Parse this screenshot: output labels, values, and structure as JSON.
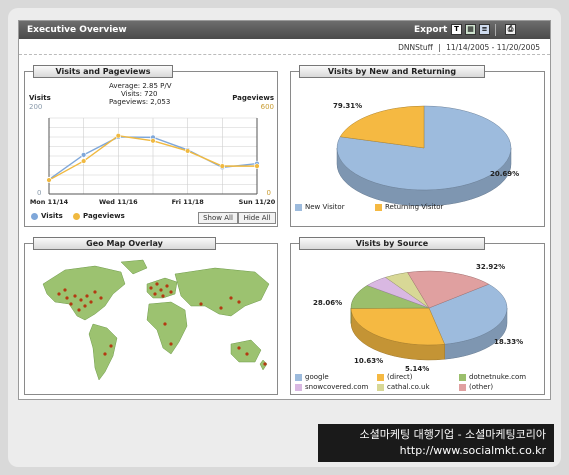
{
  "window": {
    "title": "Executive Overview",
    "export_label": "Export",
    "site": "DNNStuff",
    "date_range": "11/14/2005 - 11/20/2005"
  },
  "icons": [
    "text-export-icon",
    "excel-export-icon",
    "doc-export-icon",
    "print-icon"
  ],
  "visits_panel": {
    "title": "Visits and Pageviews",
    "left_axis_label": "Visits",
    "right_axis_label": "Pageviews",
    "left_max_label": "200",
    "right_max_label": "600",
    "left_min_label": "0",
    "right_min_label": "0",
    "summary": {
      "average": "Average: 2.85 P/V",
      "visits": "Visits: 720",
      "pageviews": "Pageviews: 2,053"
    },
    "show_all": "Show All",
    "hide_all": "Hide All"
  },
  "new_returning_panel": {
    "title": "Visits by New and Returning"
  },
  "geo_panel": {
    "title": "Geo Map Overlay"
  },
  "source_panel": {
    "title": "Visits by Source"
  },
  "chart_data": [
    {
      "type": "line",
      "title": "Visits and Pageviews",
      "x": [
        "11/14",
        "11/15",
        "11/16",
        "11/17",
        "11/18",
        "11/19",
        "11/20"
      ],
      "x_tick_labels": [
        "Mon 11/14",
        "Wed 11/16",
        "Fri 11/18",
        "Sun 11/20"
      ],
      "ylabel": "Visits",
      "y2label": "Pageviews",
      "ylim": [
        0,
        200
      ],
      "y2lim": [
        0,
        600
      ],
      "grid": true,
      "legend": "bottom-left",
      "series": [
        {
          "name": "Visits",
          "axis": "left",
          "color": "#7fa7d9",
          "values": [
            38,
            103,
            150,
            149,
            116,
            70,
            80
          ]
        },
        {
          "name": "Pageviews",
          "axis": "right",
          "color": "#f0b940",
          "values": [
            110,
            260,
            460,
            420,
            340,
            220,
            220
          ]
        }
      ]
    },
    {
      "type": "pie",
      "title": "Visits by New and Returning",
      "legend": "bottom",
      "labels": [
        "New Visitor",
        "Returning Visitor"
      ],
      "values": [
        79.31,
        20.69
      ],
      "value_labels": [
        "79.31%",
        "20.69%"
      ],
      "colors": [
        "#9dbbdd",
        "#f5b942"
      ]
    },
    {
      "type": "pie",
      "title": "Visits by Source",
      "legend": "bottom",
      "labels": [
        "google",
        "(direct)",
        "dotnetnuke.com",
        "snowcovered.com",
        "cathal.co.uk",
        "(other)"
      ],
      "values": [
        32.92,
        28.06,
        10.63,
        5.14,
        5.0,
        18.33
      ],
      "value_labels": [
        "32.92%",
        "28.06%",
        "10.63%",
        "5.14%",
        "",
        "18.33%"
      ],
      "colors": [
        "#9dbbdd",
        "#f5b942",
        "#9bbf6c",
        "#d9b8e2",
        "#d8d896",
        "#e0a0a0"
      ]
    }
  ],
  "watermark": {
    "line1": "소셜마케팅 대행기업 - 소셜마케팅코리아",
    "line2": "http://www.socialmkt.co.kr"
  }
}
